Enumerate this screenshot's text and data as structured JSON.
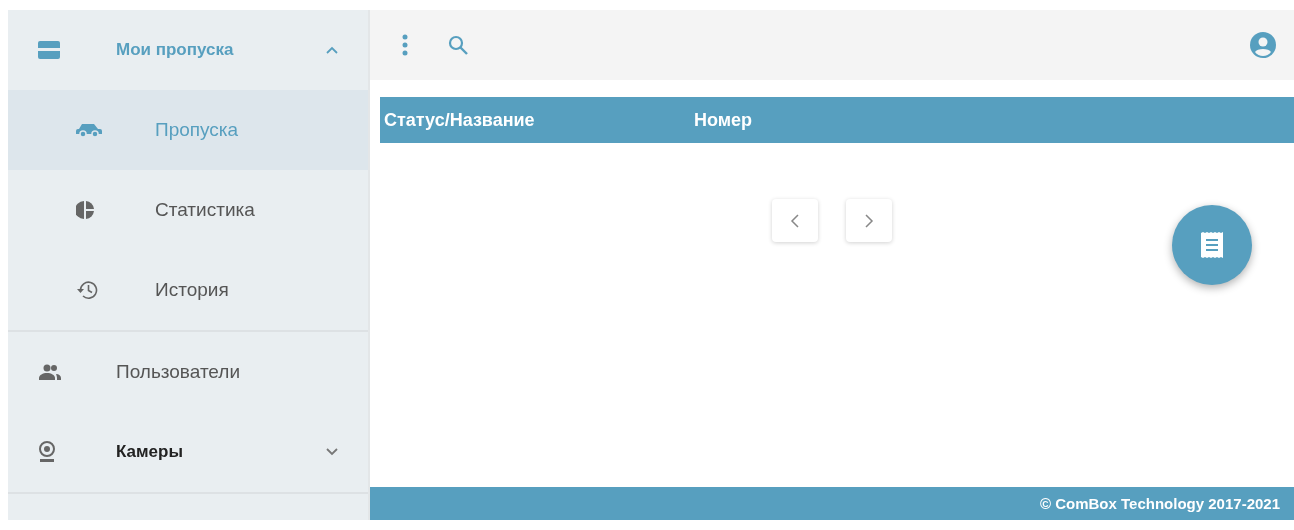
{
  "sidebar": {
    "items": [
      {
        "label": "Мои пропуска",
        "expanded": true,
        "children": [
          {
            "label": "Пропуска",
            "selected": true
          },
          {
            "label": "Статистика",
            "selected": false
          },
          {
            "label": "История",
            "selected": false
          }
        ]
      },
      {
        "label": "Пользователи",
        "selected": false
      },
      {
        "label": "Камеры",
        "expanded": false
      }
    ]
  },
  "table": {
    "columns": [
      "Статус/Название",
      "Номер"
    ]
  },
  "footer": {
    "text": "© ComBox Technology 2017-2021"
  }
}
